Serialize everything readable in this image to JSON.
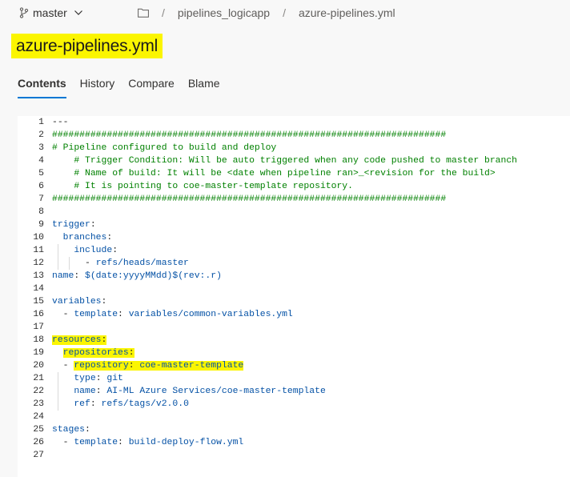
{
  "header": {
    "branch": "master",
    "breadcrumb": [
      "pipelines_logicapp",
      "azure-pipelines.yml"
    ]
  },
  "file_title": "azure-pipelines.yml",
  "tabs": [
    "Contents",
    "History",
    "Compare",
    "Blame"
  ],
  "active_tab": "Contents",
  "highlight_color": "#fbf500",
  "code_lines": [
    {
      "n": "1",
      "segs": [
        [
          "plain",
          "---"
        ]
      ]
    },
    {
      "n": "2",
      "segs": [
        [
          "comment",
          "########################################################################"
        ]
      ]
    },
    {
      "n": "3",
      "segs": [
        [
          "comment",
          "# Pipeline configured to build and deploy"
        ]
      ]
    },
    {
      "n": "4",
      "segs": [
        [
          "comment",
          "    # Trigger Condition: Will be auto triggered when any code pushed to master branch"
        ]
      ]
    },
    {
      "n": "5",
      "segs": [
        [
          "comment",
          "    # Name of build: It will be <date when pipeline ran>_<revision for the build>"
        ]
      ]
    },
    {
      "n": "6",
      "segs": [
        [
          "comment",
          "    # It is pointing to coe-master-template repository."
        ]
      ]
    },
    {
      "n": "7",
      "segs": [
        [
          "comment",
          "########################################################################"
        ]
      ]
    },
    {
      "n": "8",
      "segs": []
    },
    {
      "n": "9",
      "segs": [
        [
          "key",
          "trigger"
        ],
        [
          "plain",
          ":"
        ]
      ]
    },
    {
      "n": "10",
      "segs": [
        [
          "plain",
          "  "
        ],
        [
          "key",
          "branches"
        ],
        [
          "plain",
          ":"
        ]
      ]
    },
    {
      "n": "11",
      "segs": [
        [
          "plain",
          "    "
        ],
        [
          "key",
          "include"
        ],
        [
          "plain",
          ":"
        ]
      ]
    },
    {
      "n": "12",
      "segs": [
        [
          "plain",
          "      - "
        ],
        [
          "val",
          "refs/heads/master"
        ]
      ]
    },
    {
      "n": "13",
      "segs": [
        [
          "key",
          "name"
        ],
        [
          "plain",
          ": "
        ],
        [
          "val",
          "$(date:yyyyMMdd)$(rev:.r)"
        ]
      ]
    },
    {
      "n": "14",
      "segs": []
    },
    {
      "n": "15",
      "segs": [
        [
          "key",
          "variables"
        ],
        [
          "plain",
          ":"
        ]
      ]
    },
    {
      "n": "16",
      "segs": [
        [
          "plain",
          "  - "
        ],
        [
          "key",
          "template"
        ],
        [
          "plain",
          ": "
        ],
        [
          "val",
          "variables/common-variables.yml"
        ]
      ]
    },
    {
      "n": "17",
      "segs": []
    },
    {
      "n": "18",
      "segs": [
        [
          "key",
          "resources"
        ],
        [
          "plain",
          ":"
        ]
      ],
      "hl": true
    },
    {
      "n": "19",
      "segs": [
        [
          "plain",
          "  "
        ],
        [
          "key",
          "repositories"
        ],
        [
          "plain",
          ":"
        ]
      ],
      "hl": true
    },
    {
      "n": "20",
      "segs": [
        [
          "plain",
          "  - "
        ],
        [
          "key",
          "repository"
        ],
        [
          "plain",
          ": "
        ],
        [
          "val",
          "coe-master-template"
        ]
      ],
      "hl": true
    },
    {
      "n": "21",
      "segs": [
        [
          "plain",
          "    "
        ],
        [
          "key",
          "type"
        ],
        [
          "plain",
          ": "
        ],
        [
          "val",
          "git"
        ]
      ]
    },
    {
      "n": "22",
      "segs": [
        [
          "plain",
          "    "
        ],
        [
          "key",
          "name"
        ],
        [
          "plain",
          ": "
        ],
        [
          "val",
          "AI-ML Azure Services/coe-master-template"
        ]
      ]
    },
    {
      "n": "23",
      "segs": [
        [
          "plain",
          "    "
        ],
        [
          "key",
          "ref"
        ],
        [
          "plain",
          ": "
        ],
        [
          "val",
          "refs/tags/v2.0.0"
        ]
      ]
    },
    {
      "n": "24",
      "segs": []
    },
    {
      "n": "25",
      "segs": [
        [
          "key",
          "stages"
        ],
        [
          "plain",
          ":"
        ]
      ]
    },
    {
      "n": "26",
      "segs": [
        [
          "plain",
          "  - "
        ],
        [
          "key",
          "template"
        ],
        [
          "plain",
          ": "
        ],
        [
          "val",
          "build-deploy-flow.yml"
        ]
      ]
    },
    {
      "n": "27",
      "segs": []
    }
  ]
}
